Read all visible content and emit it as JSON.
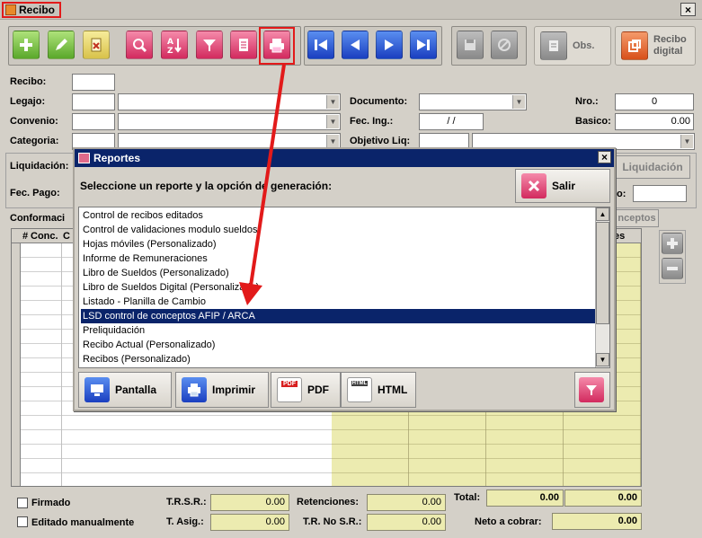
{
  "window": {
    "title": "Recibo",
    "close": "×"
  },
  "toolbar": {
    "obs_label": "Obs.",
    "recibo_digital_label1": "Recibo",
    "recibo_digital_label2": "digital"
  },
  "form": {
    "recibo_label": "Recibo:",
    "legajo_label": "Legajo:",
    "convenio_label": "Convenio:",
    "categoria_label": "Categoria:",
    "liquidacion_label": "Liquidación:",
    "fec_pago_label": "Fec. Pago:",
    "documento_label": "Documento:",
    "fec_ing_label": "Fec. Ing.:",
    "fec_ing_value": " / /",
    "objetivo_label": "Objetivo Liq:",
    "nro_label": "Nro.:",
    "nro_value": "0",
    "basico_label": "Basico:",
    "basico_value": "0.00",
    "liquidacion_btn": "Liquidación",
    "periodo_label": "o:",
    "conformacion_label": "Conformaci",
    "conceptos_btn": "nceptos"
  },
  "grid": {
    "col_hash": "#",
    "col_conc": "Conc.",
    "col_c": "C",
    "col_es": "es"
  },
  "footer": {
    "firmado_label": "Firmado",
    "editado_label": "Editado manualmente",
    "trsr_label": "T.R.S.R.:",
    "trsr_value": "0.00",
    "tasig_label": "T. Asig.:",
    "tasig_value": "0.00",
    "retenciones_label": "Retenciones:",
    "retenciones_value": "0.00",
    "trnosr_label": "T.R. No S.R.:",
    "trnosr_value": "0.00",
    "total_label": "Total:",
    "total_value1": "0.00",
    "total_value2": "0.00",
    "neto_label": "Neto a cobrar:",
    "neto_value": "0.00"
  },
  "dialog": {
    "title": "Reportes",
    "instruction": "Seleccione un reporte y la opción de generación:",
    "salir": "Salir",
    "reports": [
      "Control de recibos editados",
      "Control de validaciones modulo sueldos",
      "Hojas móviles (Personalizado)",
      "Informe de Remuneraciones",
      "Libro de Sueldos (Personalizado)",
      "Libro de Sueldos Digital (Personalizado)",
      "Listado - Planilla de Cambio",
      "LSD control de conceptos AFIP / ARCA",
      "Preliquidación",
      "Recibo Actual (Personalizado)",
      "Recibos (Personalizado)"
    ],
    "selected_index": 7,
    "btn_pantalla": "Pantalla",
    "btn_imprimir": "Imprimir",
    "btn_pdf": "PDF",
    "btn_html": "HTML",
    "pdf_badge": "PDF",
    "html_badge": "HTML"
  },
  "colors": {
    "highlight_red": "#e21a1a",
    "selection_blue": "#0a246a",
    "total_yellow": "#ecebb0"
  }
}
